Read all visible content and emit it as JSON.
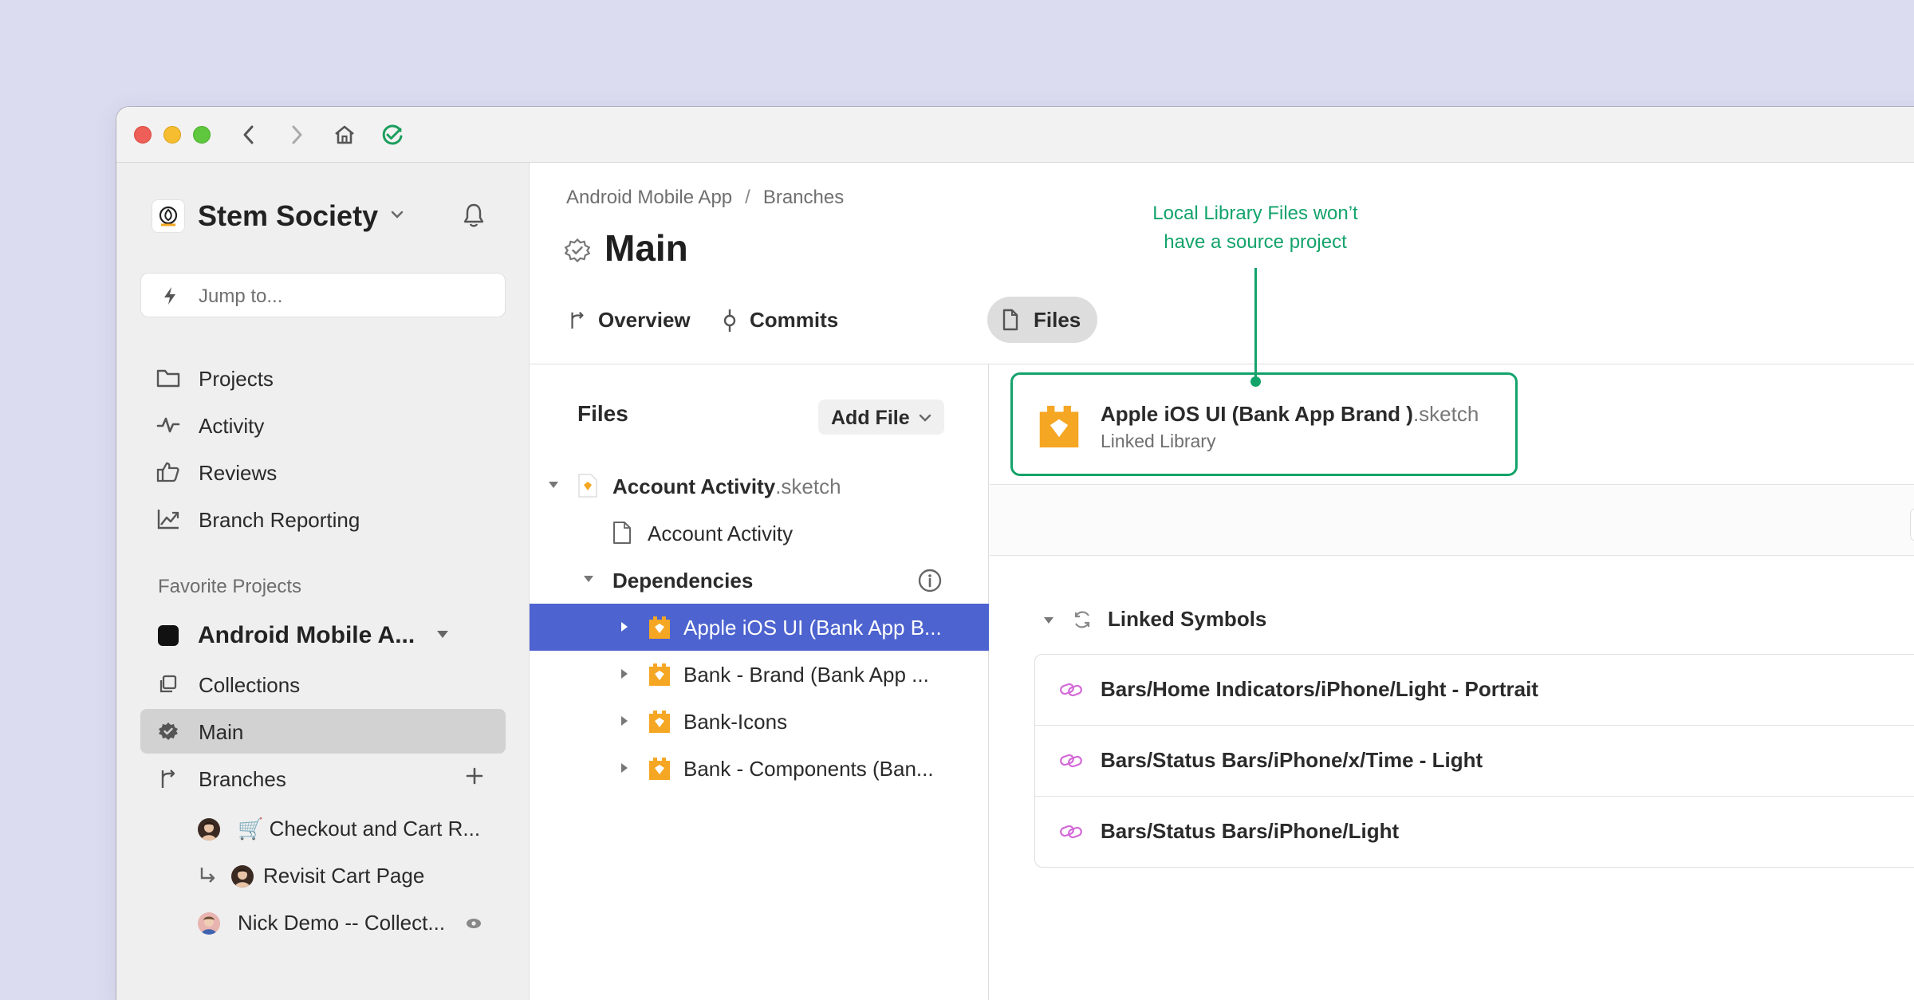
{
  "window": {
    "colors": {
      "accent_green": "#13a36b",
      "selection_blue": "#4d63cf",
      "sketch_orange": "#f5a623"
    }
  },
  "titlebar": {
    "icons": [
      "back-icon",
      "forward-icon",
      "home-icon",
      "sync-check-icon"
    ]
  },
  "sidebar": {
    "workspace": "Stem Society",
    "search_placeholder": "Jump to...",
    "nav": [
      {
        "label": "Projects",
        "icon": "folder-icon"
      },
      {
        "label": "Activity",
        "icon": "activity-icon"
      },
      {
        "label": "Reviews",
        "icon": "thumbs-up-icon"
      },
      {
        "label": "Branch Reporting",
        "icon": "chart-icon"
      }
    ],
    "favorites_label": "Favorite Projects",
    "favorite_project": "Android Mobile A...",
    "project_nav": [
      {
        "label": "Collections",
        "icon": "collections-icon"
      },
      {
        "label": "Main",
        "icon": "gear-badge-icon",
        "selected": true
      },
      {
        "label": "Branches",
        "icon": "branch-icon"
      }
    ],
    "branches": [
      {
        "label": "🛒 Checkout and Cart R..."
      },
      {
        "label": "Revisit Cart Page"
      },
      {
        "label": "Nick Demo -- Collect..."
      }
    ]
  },
  "header": {
    "breadcrumb": [
      "Android Mobile App",
      "Branches"
    ],
    "breadcrumb_sep": "/",
    "title": "Main",
    "tabs": [
      {
        "label": "Overview",
        "icon": "branch-icon"
      },
      {
        "label": "Commits",
        "icon": "commit-icon"
      },
      {
        "label": "Files",
        "icon": "file-icon",
        "active": true
      }
    ]
  },
  "files_pane": {
    "title": "Files",
    "add_file_label": "Add File",
    "tree": [
      {
        "name": "Account Activity",
        "ext": ".sketch",
        "level": 0
      },
      {
        "name": "Account Activity",
        "level": 1
      },
      {
        "name": "Dependencies",
        "level": 1
      },
      {
        "name": "Apple iOS UI (Bank App B...",
        "level": 2,
        "selected": true
      },
      {
        "name": "Bank - Brand (Bank App ...",
        "level": 2
      },
      {
        "name": "Bank-Icons",
        "level": 2
      },
      {
        "name": "Bank - Components (Ban...",
        "level": 2
      }
    ]
  },
  "detail": {
    "library_name": "Apple iOS UI (Bank App Brand )",
    "library_ext": ".sketch",
    "library_type": "Linked Library",
    "linked_symbols_label": "Linked Symbols",
    "symbols": [
      "Bars/Home Indicators/iPhone/Light - Portrait",
      "Bars/Status Bars/iPhone/x/Time - Light",
      "Bars/Status Bars/iPhone/Light"
    ]
  },
  "annotation": {
    "line1": "Local Library Files won’t",
    "line2": "have a source project"
  }
}
